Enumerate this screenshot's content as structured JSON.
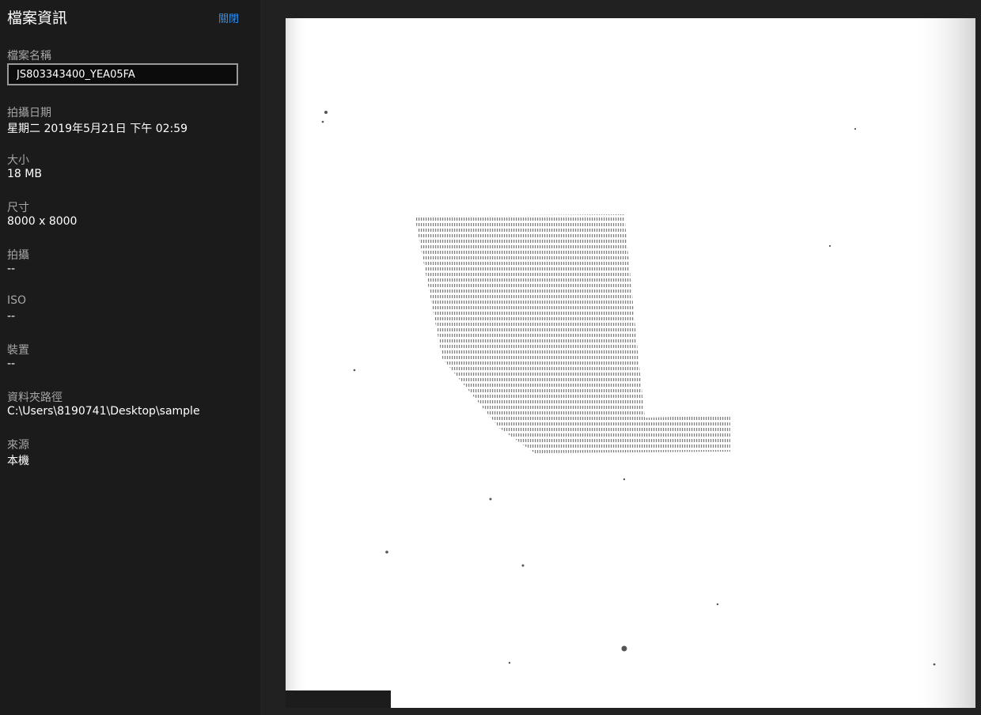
{
  "panel": {
    "title": "檔案資訊",
    "close_label": "關閉",
    "fields": {
      "filename": {
        "label": "檔案名稱",
        "value": "JS803343400_YEA05FA"
      },
      "date_taken": {
        "label": "拍攝日期",
        "value": "星期二 2019年5月21日 下午 02:59"
      },
      "size": {
        "label": "大小",
        "value": "18 MB"
      },
      "dimensions": {
        "label": "尺寸",
        "value": "8000 x 8000"
      },
      "camera": {
        "label": "拍攝",
        "value": "--"
      },
      "iso": {
        "label": "ISO",
        "value": "--"
      },
      "device": {
        "label": "裝置",
        "value": "--"
      },
      "folder_path": {
        "label": "資料夾路徑",
        "value": "C:\\Users\\8190741\\Desktop\\sample"
      },
      "source": {
        "label": "來源",
        "value": "本機"
      }
    }
  },
  "colors": {
    "accent": "#2f8ef0",
    "panel_bg": "#1b1b1b",
    "viewer_bg": "#212121",
    "label_gray": "#a6a6a6"
  }
}
